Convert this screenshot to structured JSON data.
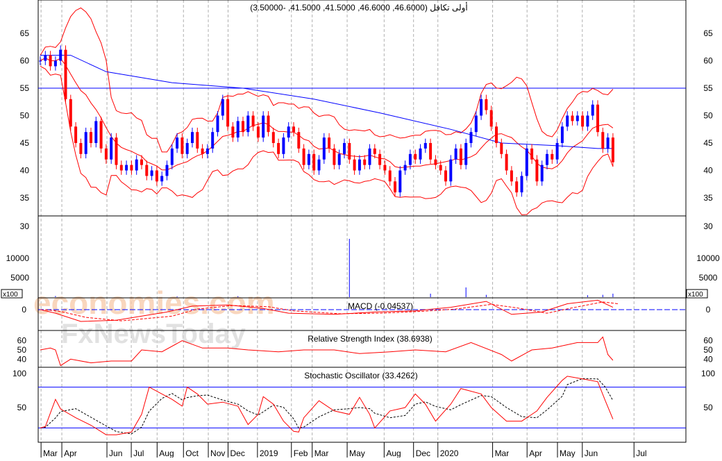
{
  "header": {
    "title": "أولى تكافل (46.6000, 46.6000, 41.5000, 41.5000, -3.50000)"
  },
  "watermark": {
    "line1": "economies.com",
    "line2": "FxNewsToday"
  },
  "colors": {
    "up": "#0000ff",
    "down": "#ff0000",
    "ma": "#0000ff",
    "bands": "#ff0000",
    "grid": "#b0b0b0"
  },
  "chart_data": [
    {
      "type": "candlestick",
      "title": "أولى تكافل (46.6000, 46.6000, 41.5000, 41.5000, -3.50000)",
      "ylim": [
        32,
        68
      ],
      "yticks": [
        35,
        40,
        45,
        50,
        55,
        60,
        65
      ],
      "ytick_labels": [
        "35",
        "40",
        "45",
        "50",
        "55",
        "60",
        "65"
      ],
      "bottom_label": "30",
      "reference_line": 55,
      "closes": [
        60,
        61,
        59,
        60,
        62,
        53,
        48,
        45,
        43,
        47,
        45,
        49,
        44,
        42,
        46,
        41,
        40,
        41,
        40,
        42,
        41,
        39,
        40,
        38,
        39,
        41,
        44,
        46,
        43,
        45,
        47,
        44,
        43,
        44,
        47,
        50,
        53,
        48,
        46,
        49,
        47,
        50,
        48,
        46,
        50,
        47,
        45,
        43,
        46,
        48,
        47,
        44,
        41,
        43,
        40,
        42,
        46,
        44,
        41,
        43,
        45,
        42,
        40,
        42,
        41,
        44,
        43,
        41,
        40,
        38,
        36,
        40,
        41,
        43,
        42,
        44,
        45,
        42,
        41,
        40,
        38,
        42,
        44,
        41,
        45,
        47,
        50,
        53,
        51,
        48,
        45,
        43,
        40,
        38,
        36,
        39,
        44,
        42,
        38,
        41,
        43,
        42,
        45,
        48,
        50,
        49,
        50,
        48,
        50,
        52,
        47,
        44,
        46,
        41.5
      ],
      "moving_average": [
        [
          0,
          61
        ],
        [
          6,
          61
        ],
        [
          13,
          58
        ],
        [
          26,
          56
        ],
        [
          40,
          55
        ],
        [
          54,
          53
        ],
        [
          67,
          50.5
        ],
        [
          81,
          47.5
        ],
        [
          91,
          45
        ],
        [
          102,
          44.5
        ],
        [
          110,
          44
        ],
        [
          113,
          44
        ]
      ],
      "x_tick_labels": [
        "Mar",
        "Apr",
        "Jun",
        "Jul",
        "Aug",
        "Oct",
        "Nov",
        "Dec",
        "2019",
        "Feb",
        "Mar",
        "May",
        "Aug",
        "Dec",
        "2020",
        "Mar",
        "Apr",
        "May",
        "Jun",
        "Jul"
      ],
      "x_tick_index": [
        1.8,
        5.9,
        14.8,
        19.6,
        24.7,
        29.9,
        34.8,
        38.7,
        44.5,
        51.2,
        55.3,
        62.2,
        69.5,
        75.3,
        80.1,
        90.9,
        97.7,
        103.7,
        108.6,
        118.8
      ]
    },
    {
      "type": "bar",
      "name": "Volume",
      "unit_label": "x100",
      "yticks": [
        5000,
        10000
      ],
      "ytick_labels": [
        "5000",
        "10000"
      ],
      "spikes": [
        [
          3,
          300
        ],
        [
          27,
          200
        ],
        [
          39,
          250
        ],
        [
          61,
          15000
        ],
        [
          77,
          900
        ],
        [
          84,
          2500
        ],
        [
          88,
          600
        ],
        [
          108,
          500
        ],
        [
          111,
          600
        ],
        [
          113,
          900
        ]
      ]
    },
    {
      "type": "line",
      "name": "MACD",
      "label": "MACD (-0.04537)",
      "ytick_labels": [
        "0"
      ],
      "values": [
        [
          0,
          0
        ],
        [
          3,
          -0.3
        ],
        [
          8,
          -1.0
        ],
        [
          15,
          -0.9
        ],
        [
          25,
          -0.2
        ],
        [
          30,
          0.3
        ],
        [
          37,
          0.4
        ],
        [
          44,
          0.1
        ],
        [
          49,
          -0.3
        ],
        [
          58,
          -0.4
        ],
        [
          66,
          -0.2
        ],
        [
          74,
          -0.1
        ],
        [
          81,
          0.2
        ],
        [
          88,
          0.7
        ],
        [
          93,
          -0.4
        ],
        [
          99,
          -0.2
        ],
        [
          104,
          0.5
        ],
        [
          110,
          0.8
        ],
        [
          113,
          0.2
        ]
      ]
    },
    {
      "type": "line",
      "name": "RSI",
      "label": "Relative Strength Index (38.6938)",
      "yticks": [
        40,
        50,
        60
      ],
      "ytick_labels": [
        "40",
        "50",
        "60"
      ],
      "values": [
        [
          0,
          50
        ],
        [
          2,
          52
        ],
        [
          3,
          50
        ],
        [
          4,
          33
        ],
        [
          6,
          40
        ],
        [
          10,
          36
        ],
        [
          14,
          38
        ],
        [
          18,
          38
        ],
        [
          20,
          50
        ],
        [
          24,
          48
        ],
        [
          28,
          60
        ],
        [
          32,
          52
        ],
        [
          37,
          52
        ],
        [
          41,
          50
        ],
        [
          47,
          48
        ],
        [
          52,
          50
        ],
        [
          58,
          50
        ],
        [
          63,
          46
        ],
        [
          69,
          48
        ],
        [
          74,
          50
        ],
        [
          80,
          48
        ],
        [
          85,
          58
        ],
        [
          91,
          45
        ],
        [
          93,
          38
        ],
        [
          97,
          50
        ],
        [
          101,
          52
        ],
        [
          106,
          58
        ],
        [
          110,
          58
        ],
        [
          111,
          64
        ],
        [
          112,
          45
        ],
        [
          113,
          38.7
        ]
      ]
    },
    {
      "type": "line",
      "name": "Stochastic",
      "label": "Stochastic Oscillator (33.4262)",
      "yticks": [
        50,
        100
      ],
      "ytick_labels": [
        "50",
        "100"
      ],
      "levels": [
        20,
        80
      ],
      "values": [
        [
          0,
          20
        ],
        [
          1,
          22
        ],
        [
          3,
          62
        ],
        [
          4,
          48
        ],
        [
          7,
          35
        ],
        [
          10,
          24
        ],
        [
          13,
          10
        ],
        [
          15,
          10
        ],
        [
          18,
          14
        ],
        [
          20,
          40
        ],
        [
          21.5,
          80
        ],
        [
          24,
          70
        ],
        [
          26,
          62
        ],
        [
          28,
          52
        ],
        [
          29,
          80
        ],
        [
          31,
          70
        ],
        [
          33,
          55
        ],
        [
          36,
          58
        ],
        [
          39,
          52
        ],
        [
          41,
          25
        ],
        [
          43,
          40
        ],
        [
          44,
          66
        ],
        [
          46,
          55
        ],
        [
          48,
          30
        ],
        [
          50,
          15
        ],
        [
          51,
          14
        ],
        [
          52,
          35
        ],
        [
          55,
          60
        ],
        [
          58,
          45
        ],
        [
          61,
          40
        ],
        [
          63,
          65
        ],
        [
          65,
          40
        ],
        [
          66,
          20
        ],
        [
          69,
          45
        ],
        [
          72,
          50
        ],
        [
          74,
          70
        ],
        [
          76,
          55
        ],
        [
          78,
          30
        ],
        [
          81,
          55
        ],
        [
          83,
          78
        ],
        [
          87,
          70
        ],
        [
          89,
          50
        ],
        [
          92,
          30
        ],
        [
          95,
          30
        ],
        [
          98,
          45
        ],
        [
          100,
          65
        ],
        [
          103,
          90
        ],
        [
          104,
          96
        ],
        [
          107,
          92
        ],
        [
          110,
          88
        ],
        [
          111.5,
          60
        ],
        [
          113,
          33
        ]
      ]
    }
  ]
}
